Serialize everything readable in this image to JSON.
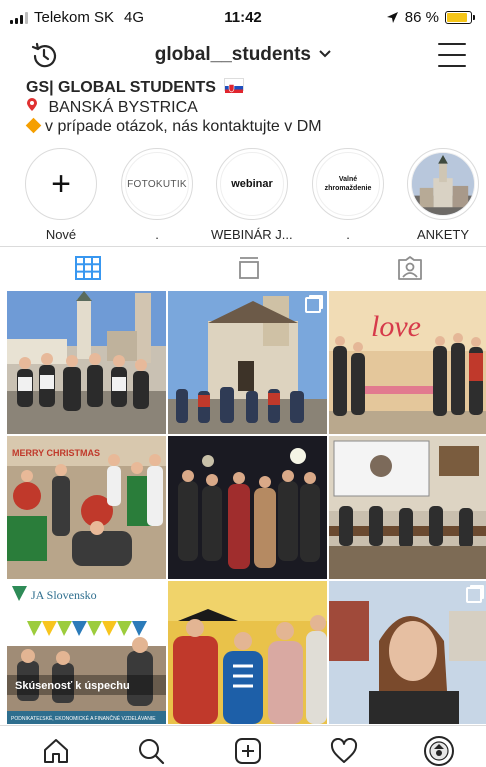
{
  "status_bar": {
    "carrier": "Telekom SK",
    "network": "4G",
    "time": "11:42",
    "battery": "86 %",
    "battery_level": 0.86,
    "battery_color": "#f5c518"
  },
  "nav": {
    "username": "global__students",
    "dropdown_icon": "chevron-down-icon",
    "left_icon": "history-icon",
    "right_icon": "hamburger-menu-icon"
  },
  "bio": {
    "name": "GS| GLOBAL STUDENTS",
    "flag_icon": "slovakia-flag-icon",
    "location_icon": "location-pin-icon",
    "location": "BANSKÁ BYSTRICA",
    "contact_icon": "orange-diamond-icon",
    "contact": "v prípade otázok, nás kontaktujte v DM"
  },
  "highlights": [
    {
      "label": "Nové",
      "cover": "plus-icon"
    },
    {
      "label": ".",
      "cover_text": "FOTOKUTIK"
    },
    {
      "label": "WEBINÁR J....",
      "cover_text": "webinar"
    },
    {
      "label": ".",
      "cover_text_1": "Valné",
      "cover_text_2": "zhromaždenie"
    },
    {
      "label": "ANKETY",
      "cover": "church-photo"
    }
  ],
  "tabs": [
    {
      "name": "grid-tab",
      "icon": "grid-icon",
      "active": true
    },
    {
      "name": "igtv-tab",
      "icon": "igtv-icon",
      "active": false
    },
    {
      "name": "tagged-tab",
      "icon": "tagged-icon",
      "active": false
    }
  ],
  "accent_color": "#3897f0",
  "posts": [
    {
      "desc": "group on town square",
      "multi": false
    },
    {
      "desc": "castle courtyard group",
      "multi": true
    },
    {
      "desc": "love booth event",
      "multi": false
    },
    {
      "desc": "christmas party",
      "multi": false
    },
    {
      "desc": "night group photo",
      "multi": false
    },
    {
      "desc": "seminar room",
      "multi": false
    },
    {
      "desc": "JA Slovensko poster",
      "multi": false,
      "brand": "JA Slovensko",
      "headline": "Skúsenosť k úspechu",
      "footer": "PODNIKATEĽSKÉ, EKONOMICKÉ A FINANČNÉ VZDELÁVANIE"
    },
    {
      "desc": "costume party",
      "multi": false
    },
    {
      "desc": "selfie portrait",
      "multi": true
    }
  ],
  "bottom_nav": [
    {
      "name": "home-tab",
      "icon": "home-icon"
    },
    {
      "name": "search-tab",
      "icon": "search-icon"
    },
    {
      "name": "new-post-tab",
      "icon": "add-post-icon"
    },
    {
      "name": "activity-tab",
      "icon": "heart-icon"
    },
    {
      "name": "profile-tab",
      "icon": "profile-avatar-icon"
    }
  ]
}
